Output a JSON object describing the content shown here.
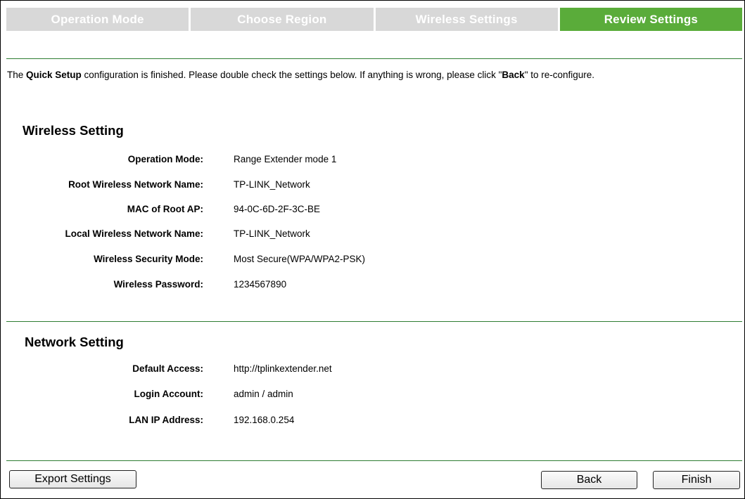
{
  "steps": [
    {
      "label": "Operation Mode",
      "active": false
    },
    {
      "label": "Choose Region",
      "active": false
    },
    {
      "label": "Wireless Settings",
      "active": false
    },
    {
      "label": "Review Settings",
      "active": true
    }
  ],
  "intro": {
    "part1": "The ",
    "quick_setup": "Quick Setup",
    "part2": " configuration is finished. Please double check the settings below. If anything is wrong, please click \"",
    "back_word": "Back",
    "part3": "\" to re-configure."
  },
  "wireless": {
    "title": "Wireless Setting",
    "rows": [
      {
        "label": "Operation Mode:",
        "value": "Range Extender mode 1"
      },
      {
        "label": "Root Wireless Network Name:",
        "value": "TP-LINK_Network"
      },
      {
        "label": "MAC of Root AP:",
        "value": "94-0C-6D-2F-3C-BE"
      },
      {
        "label": "Local Wireless Network Name:",
        "value": "TP-LINK_Network"
      },
      {
        "label": "Wireless Security Mode:",
        "value": "Most Secure(WPA/WPA2-PSK)"
      },
      {
        "label": "Wireless Password:",
        "value": "1234567890"
      }
    ]
  },
  "network": {
    "title": "Network Setting",
    "rows": [
      {
        "label": "Default Access:",
        "value": "http://tplinkextender.net"
      },
      {
        "label": "Login Account:",
        "value": "admin /  admin"
      },
      {
        "label": "LAN IP Address:",
        "value": "192.168.0.254"
      }
    ]
  },
  "buttons": {
    "export": "Export Settings",
    "back": "Back",
    "finish": "Finish"
  },
  "colors": {
    "active_tab": "#5aac3a",
    "inactive_tab": "#d8d8d8",
    "divider": "#2e7d32"
  }
}
